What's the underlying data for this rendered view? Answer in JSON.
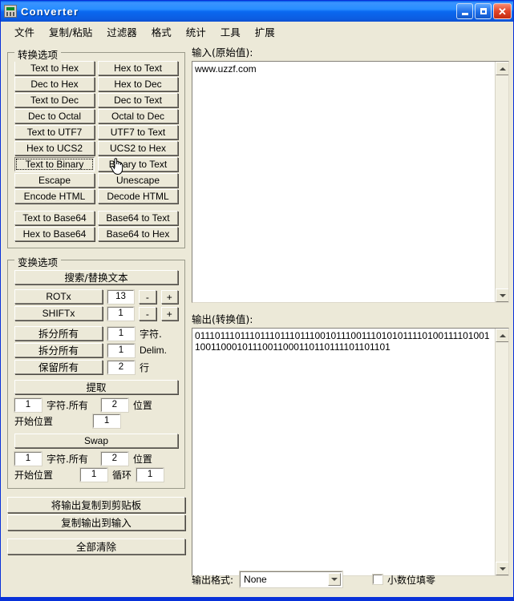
{
  "window": {
    "title": "Converter",
    "icon": "calculator-icon",
    "minimize_label": "_",
    "maximize_label": "□",
    "close_label": "✕",
    "accent_color": "#0831d9",
    "face_color": "#ece9d8"
  },
  "menubar": {
    "items": [
      {
        "label": "文件"
      },
      {
        "label": "复制/粘贴"
      },
      {
        "label": "过滤器"
      },
      {
        "label": "格式"
      },
      {
        "label": "统计"
      },
      {
        "label": "工具"
      },
      {
        "label": "扩展"
      }
    ]
  },
  "conversion_options": {
    "title": "转换选项",
    "rows": [
      {
        "left": "Text to Hex",
        "right": "Hex to Text"
      },
      {
        "left": "Dec to Hex",
        "right": "Hex to Dec"
      },
      {
        "left": "Text to Dec",
        "right": "Dec to Text"
      },
      {
        "left": "Dec to Octal",
        "right": "Octal to Dec"
      },
      {
        "left": "Text to UTF7",
        "right": "UTF7 to Text"
      },
      {
        "left": "Hex to UCS2",
        "right": "UCS2 to Hex"
      },
      {
        "left": "Text to Binary",
        "right": "Binary to Text"
      },
      {
        "left": "Escape",
        "right": "Unescape"
      },
      {
        "left": "Encode HTML",
        "right": "Decode HTML"
      }
    ],
    "base64_rows": [
      {
        "left": "Text to Base64",
        "right": "Base64 to Text"
      },
      {
        "left": "Hex to Base64",
        "right": "Base64 to Hex"
      }
    ],
    "focused_button": "Text to Binary"
  },
  "transform_options": {
    "title": "变换选项",
    "search_replace_label": "搜索/替换文本",
    "rot": {
      "label": "ROTx",
      "value": "13",
      "minus": "-",
      "plus": "+"
    },
    "shift": {
      "label": "SHIFTx",
      "value": "1",
      "minus": "-",
      "plus": "+"
    },
    "split_chars": {
      "label": "拆分所有",
      "value": "1",
      "unit": "字符."
    },
    "split_delim": {
      "label": "拆分所有",
      "value": "1",
      "unit": "Delim."
    },
    "keep_lines": {
      "label": "保留所有",
      "value": "2",
      "unit": "行"
    },
    "extract_label": "提取",
    "extract": {
      "count": "1",
      "count_unit": "字符.所有",
      "pos": "2",
      "pos_unit": "位置",
      "start_label": "开始位置",
      "start": "1"
    },
    "swap_label": "Swap",
    "swap": {
      "count": "1",
      "count_unit": "字符.所有",
      "pos": "2",
      "pos_unit": "位置",
      "start_label": "开始位置",
      "start": "1",
      "loop_label": "循环",
      "loop": "1"
    }
  },
  "actions": {
    "copy_output_to_clipboard": "将输出复制到剪贴板",
    "copy_output_to_input": "复制输出到输入",
    "clear_all": "全部清除"
  },
  "input_panel": {
    "label": "输入(原始值):",
    "value": "www.uzzf.com",
    "scroll_up": "scrollbar-up-arrow",
    "scroll_down": "scrollbar-down-arrow"
  },
  "output_panel": {
    "label": "输出(转换值):",
    "value": "011101110111011101110111001011100111010101111010011110100110011000101110011000110110111101101101"
  },
  "bottom_bar": {
    "format_label": "输出格式:",
    "format_value": "None",
    "dropdown_icon": "chevron-down-icon",
    "checkbox_label": "小数位填零",
    "checkbox_checked": false
  },
  "cursor": {
    "type": "hand-pointer-cursor"
  }
}
